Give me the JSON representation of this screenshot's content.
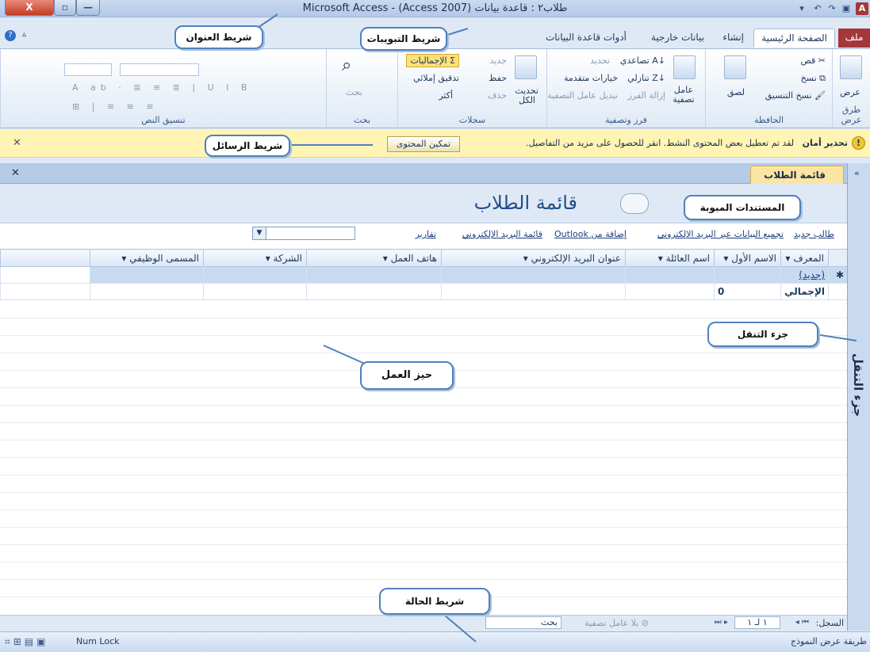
{
  "window": {
    "title": "Microsoft Access - (Access 2007) طلاب٢ : قاعدة بيانات",
    "controls": {
      "close": "X",
      "maximize": "▫",
      "minimize": "—"
    }
  },
  "tabs": [
    "ملف",
    "الصفحة الرئيسية",
    "إنشاء",
    "بيانات خارجية",
    "أدوات قاعدة البيانات"
  ],
  "ribbon": {
    "view": {
      "label": "عرض",
      "group": "طرق عرض"
    },
    "clipboard": {
      "group": "الحافظة",
      "paste": "لصق",
      "cut": "قص",
      "copy": "نسخ",
      "format_painter": "نسخ التنسيق"
    },
    "sort_filter": {
      "group": "فرز وتصفية",
      "filter": "عامل تصفية",
      "ascending": "تصاعدي",
      "descending": "تنازلي",
      "remove_sort": "إزالة الفرز",
      "selection": "تحديد",
      "advanced": "خيارات متقدمة",
      "toggle_filter": "تبديل عامل التصفية"
    },
    "records": {
      "group": "سجلات",
      "refresh": "تحديث",
      "refresh_all": "الكل",
      "new": "جديد",
      "save": "حفظ",
      "delete": "حذف",
      "totals": "الإجماليات",
      "spelling": "تدقيق إملائي",
      "more": "أكثر"
    },
    "find": {
      "group": "بحث",
      "label": "بحث"
    },
    "text_format": {
      "group": "تنسيق النص"
    }
  },
  "message_bar": {
    "title": "تحذير أمان",
    "text": "لقد تم تعطيل بعض المحتوى النشط. انقر للحصول على مزيد من التفاصيل.",
    "button": "تمكين المحتوى"
  },
  "doc_tab": "قائمة الطلاب",
  "form": {
    "title": "قائمة الطلاب",
    "links": [
      "طالب جديد",
      "تجميع البيانات عبر البريد الإلكتروني",
      "إضافة من Outlook",
      "قائمة البريد الإلكتروني",
      "تقارير"
    ]
  },
  "table": {
    "columns": [
      "المعرف",
      "الاسم الأول",
      "اسم العائلة",
      "عنوان البريد الإلكتروني",
      "هاتف العمل",
      "الشركة",
      "المسمى الوظيفي"
    ],
    "new_row": "(جديد)",
    "total_label": "الإجمالي",
    "total_value": "0"
  },
  "record_nav": {
    "label": "السجل:",
    "position": "١ لـ ١",
    "filter": "بلا عامل تصفية",
    "search": "بحث"
  },
  "status": {
    "left": "طريقة عرض النموذج",
    "num_lock": "Num Lock"
  },
  "nav_pane": "جزء التنقل",
  "callouts": {
    "title_bar": "شريط العنوان",
    "tabs_bar": "شريط التبويبات",
    "message_bar": "شريط الرسائل",
    "tabbed_docs": "المستندات المبوبة",
    "nav_pane": "جزء التنقل",
    "work_area": "حيز العمل",
    "status_bar": "شريط الحالة"
  }
}
